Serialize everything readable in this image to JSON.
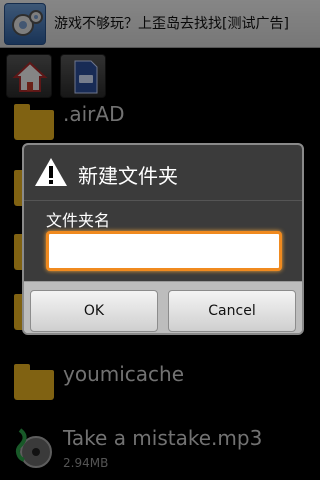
{
  "ad": {
    "text": "游戏不够玩？上歪岛去找找[测试广告]",
    "icon": "gear-icon"
  },
  "toolbar": {
    "home_icon": "home-icon",
    "sd_icon": "sd-card-icon"
  },
  "files": [
    {
      "name": ".airAD",
      "type": "folder"
    },
    {
      "name": "youmicache",
      "type": "folder"
    },
    {
      "name": "Take a mistake.mp3",
      "size": "2.94MB",
      "type": "music"
    }
  ],
  "dialog": {
    "title": "新建文件夹",
    "field_label": "文件夹名",
    "input_value": "",
    "ok_label": "OK",
    "cancel_label": "Cancel",
    "icon": "warning-icon"
  },
  "colors": {
    "folder": "#e9b322",
    "input_focus": "#f08a1f",
    "dialog_bg": "#3b3b3b"
  }
}
